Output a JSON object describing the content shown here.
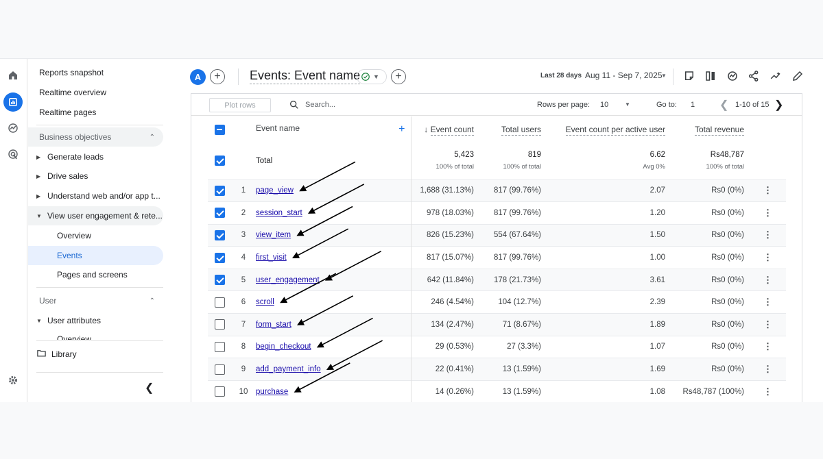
{
  "nav": {
    "reports_snapshot": "Reports snapshot",
    "realtime_overview": "Realtime overview",
    "realtime_pages": "Realtime pages",
    "business_objectives": "Business objectives",
    "generate_leads": "Generate leads",
    "drive_sales": "Drive sales",
    "understand_web": "Understand web and/or app t...",
    "view_engagement": "View user engagement & rete...",
    "overview": "Overview",
    "events": "Events",
    "pages_and_screens": "Pages and screens",
    "user": "User",
    "user_attributes": "User attributes",
    "user_overview": "Overview",
    "library": "Library"
  },
  "header": {
    "avatar_letter": "A",
    "title": "Events: Event name",
    "date_label": "Last 28 days",
    "date_range": "Aug 11 - Sep 7, 2025"
  },
  "toolbar": {
    "plot_rows": "Plot rows",
    "search_placeholder": "Search...",
    "rows_per_page_label": "Rows per page:",
    "rows_per_page": "10",
    "goto_label": "Go to:",
    "goto_value": "1",
    "range": "1-10 of 15"
  },
  "table": {
    "columns": {
      "event_name": "Event name",
      "event_count": "Event count",
      "total_users": "Total users",
      "per_user": "Event count per active user",
      "revenue": "Total revenue"
    },
    "total": {
      "label": "Total",
      "event_count": "5,423",
      "event_count_sub": "100% of total",
      "total_users": "819",
      "total_users_sub": "100% of total",
      "per_user": "6.62",
      "per_user_sub": "Avg 0%",
      "revenue": "Rs48,787",
      "revenue_sub": "100% of total"
    },
    "rows": [
      {
        "idx": "1",
        "name": "page_view",
        "count": "1,688 (31.13%)",
        "users": "817 (99.76%)",
        "per_user": "2.07",
        "revenue": "Rs0 (0%)",
        "checked": true
      },
      {
        "idx": "2",
        "name": "session_start",
        "count": "978 (18.03%)",
        "users": "817 (99.76%)",
        "per_user": "1.20",
        "revenue": "Rs0 (0%)",
        "checked": true
      },
      {
        "idx": "3",
        "name": "view_item",
        "count": "826 (15.23%)",
        "users": "554 (67.64%)",
        "per_user": "1.50",
        "revenue": "Rs0 (0%)",
        "checked": true
      },
      {
        "idx": "4",
        "name": "first_visit",
        "count": "817 (15.07%)",
        "users": "817 (99.76%)",
        "per_user": "1.00",
        "revenue": "Rs0 (0%)",
        "checked": true
      },
      {
        "idx": "5",
        "name": "user_engagement",
        "count": "642 (11.84%)",
        "users": "178 (21.73%)",
        "per_user": "3.61",
        "revenue": "Rs0 (0%)",
        "checked": true
      },
      {
        "idx": "6",
        "name": "scroll",
        "count": "246 (4.54%)",
        "users": "104 (12.7%)",
        "per_user": "2.39",
        "revenue": "Rs0 (0%)",
        "checked": false
      },
      {
        "idx": "7",
        "name": "form_start",
        "count": "134 (2.47%)",
        "users": "71 (8.67%)",
        "per_user": "1.89",
        "revenue": "Rs0 (0%)",
        "checked": false
      },
      {
        "idx": "8",
        "name": "begin_checkout",
        "count": "29 (0.53%)",
        "users": "27 (3.3%)",
        "per_user": "1.07",
        "revenue": "Rs0 (0%)",
        "checked": false
      },
      {
        "idx": "9",
        "name": "add_payment_info",
        "count": "22 (0.41%)",
        "users": "13 (1.59%)",
        "per_user": "1.69",
        "revenue": "Rs0 (0%)",
        "checked": false
      },
      {
        "idx": "10",
        "name": "purchase",
        "count": "14 (0.26%)",
        "users": "13 (1.59%)",
        "per_user": "1.08",
        "revenue": "Rs48,787 (100%)",
        "checked": false
      }
    ]
  },
  "colors": {
    "accent": "#1a73e8",
    "link": "#1a0dab",
    "annotation_arrow": "#000000"
  },
  "icons": [
    "home-icon",
    "reports-icon",
    "explore-icon",
    "advertising-icon",
    "settings-icon",
    "folder-icon",
    "collapse-icon",
    "search-icon",
    "check-circle-icon",
    "compare-icon",
    "insights-icon",
    "share-icon",
    "customize-icon",
    "edit-icon",
    "comment-icon"
  ]
}
